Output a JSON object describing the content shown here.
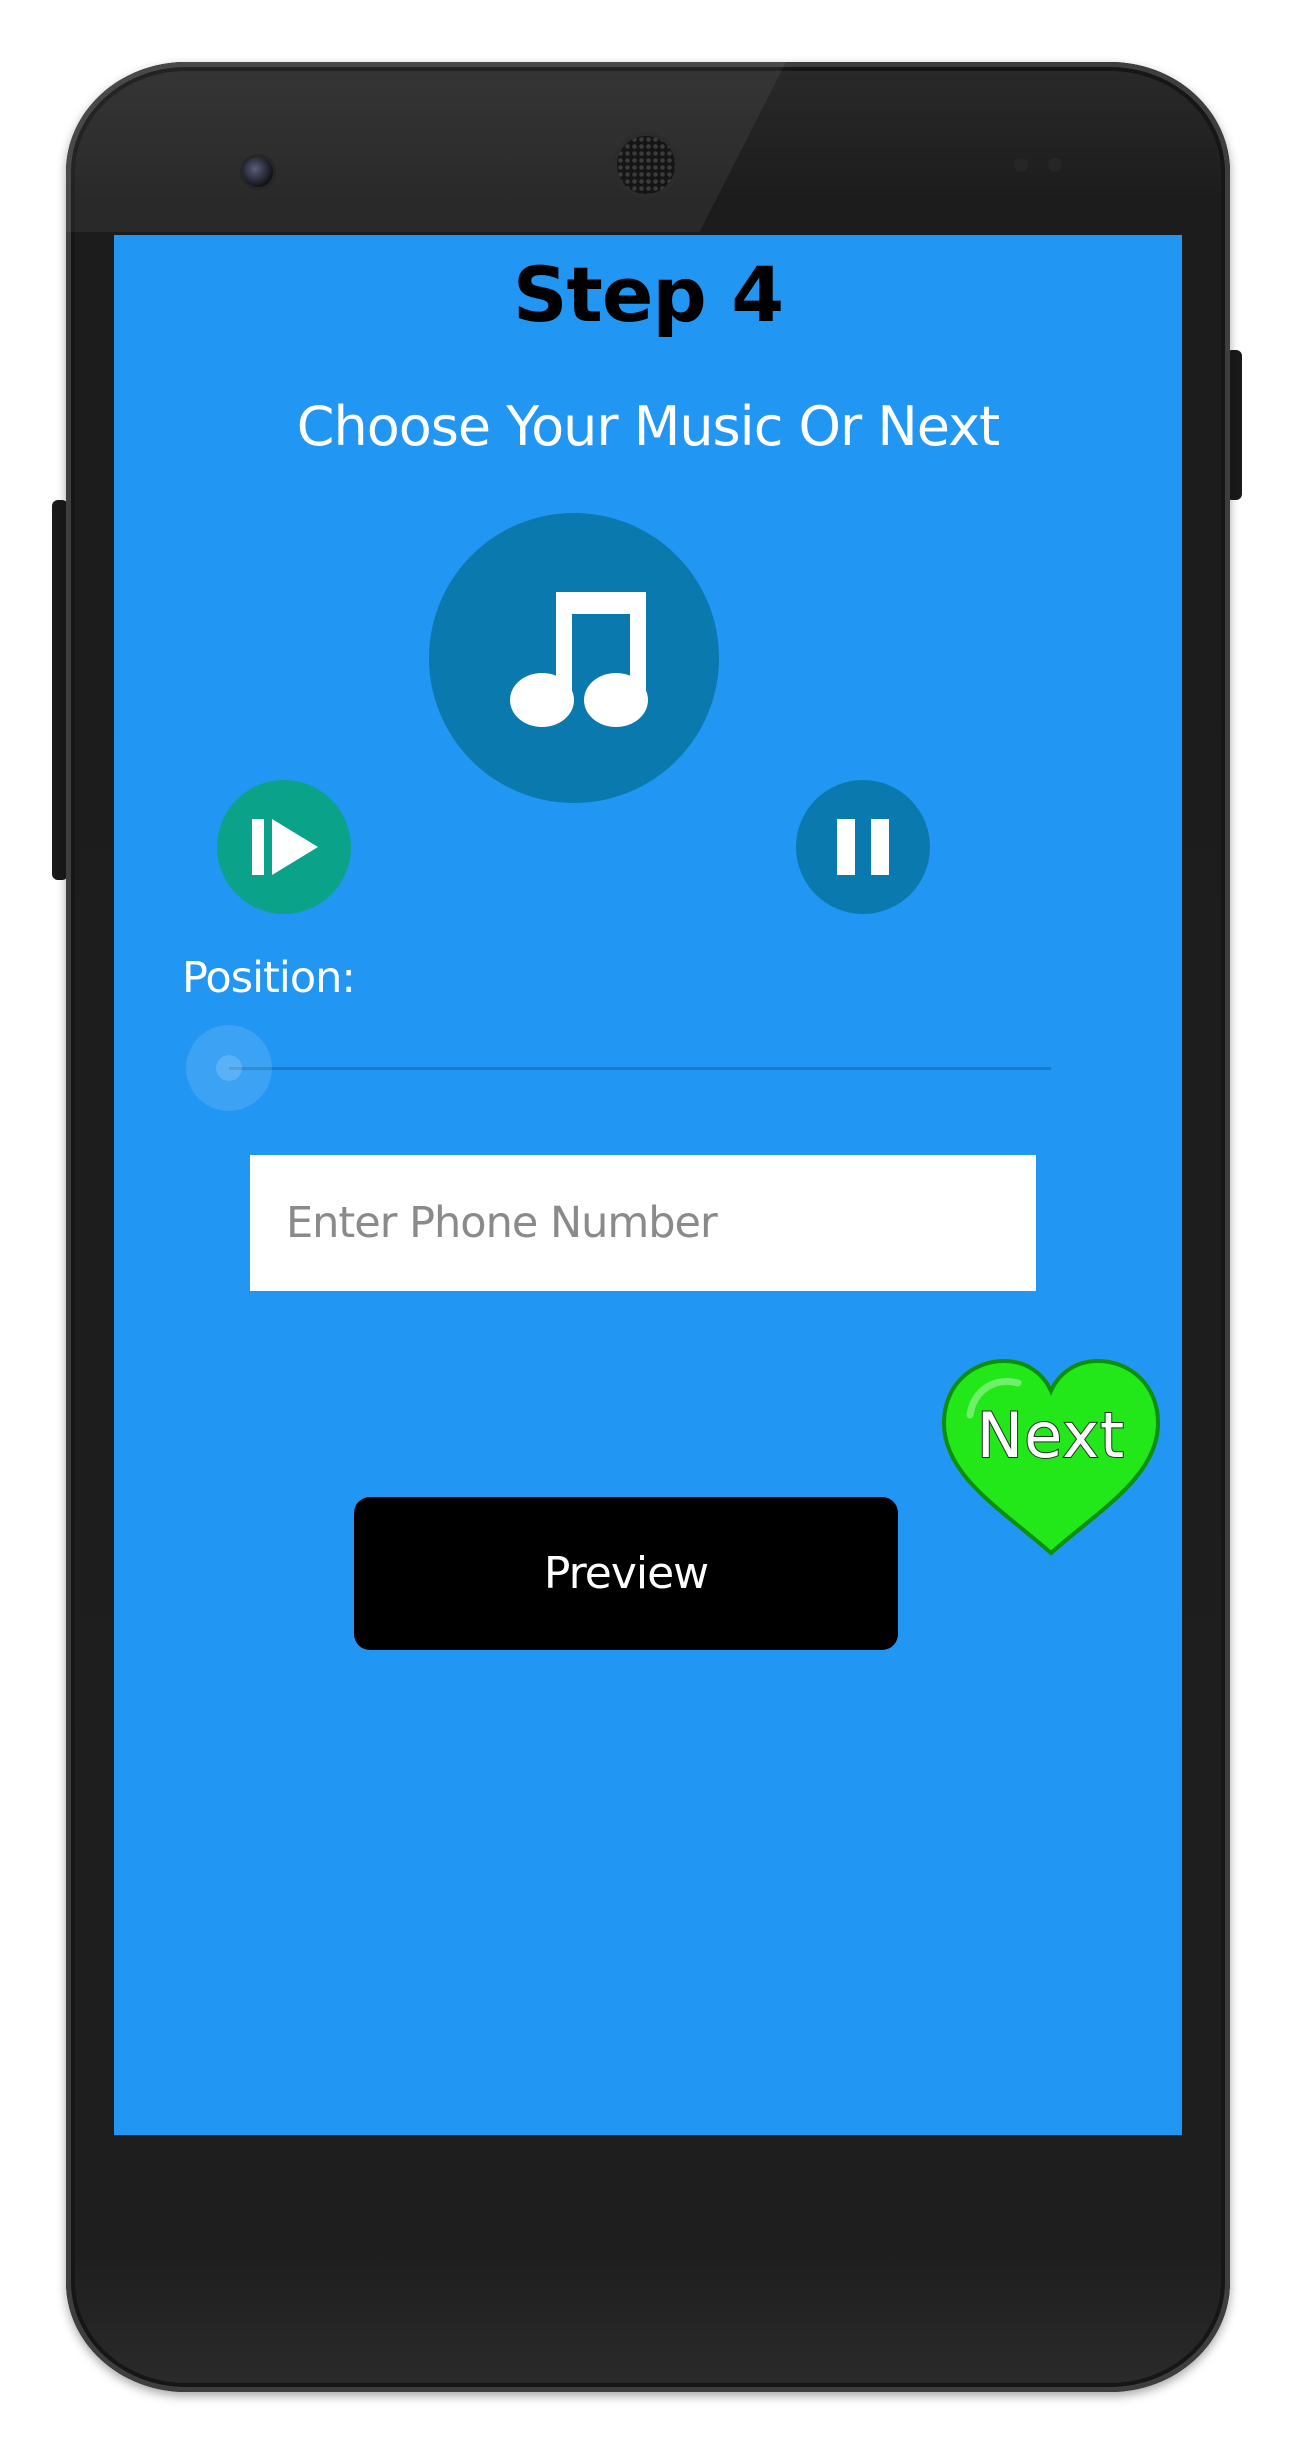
{
  "screen": {
    "title": "Step 4",
    "subtitle": "Choose Your Music Or Next",
    "position_label": "Position:",
    "seek_progress": 0,
    "phone_input": {
      "value": "",
      "placeholder": "Enter Phone Number"
    },
    "next_label": "Next",
    "preview_label": "Preview"
  },
  "icons": {
    "music": "music-note-icon",
    "play": "play-icon",
    "pause": "pause-icon",
    "next": "heart-icon"
  },
  "colors": {
    "screen_background": "#2196f3",
    "music_button": "#0a79ad",
    "play_button": "#0aa38a",
    "pause_button": "#0a79ad",
    "next_heart": "#22e81a",
    "preview_button": "#000000"
  }
}
